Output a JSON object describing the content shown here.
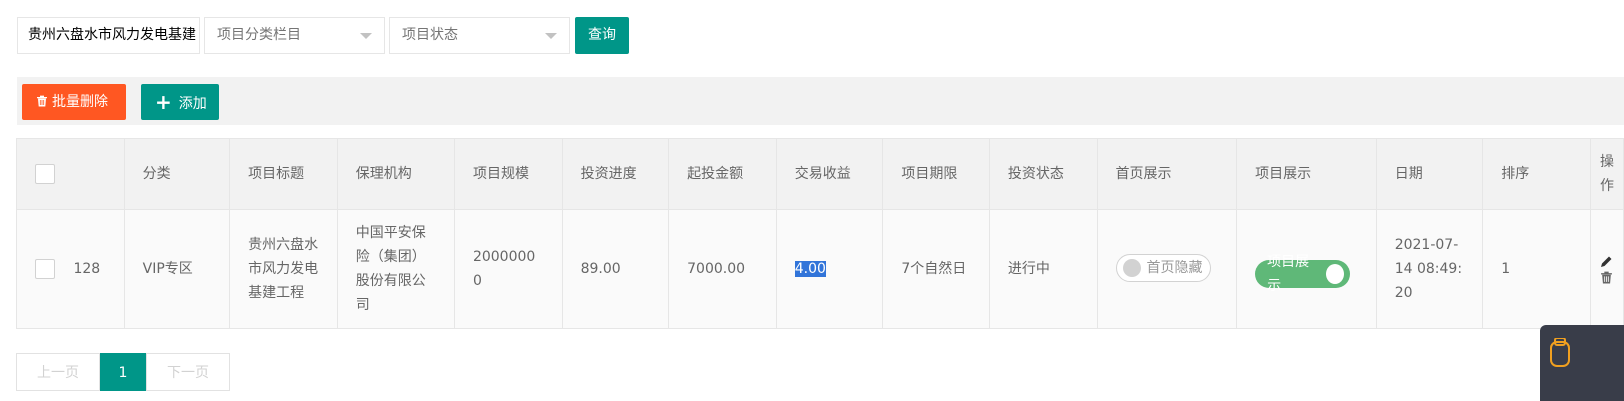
{
  "filters": {
    "project_name_value": "贵州六盘水市风力发电基建",
    "category_select": "项目分类栏目",
    "status_select": "项目状态",
    "query_label": "查询"
  },
  "toolbar": {
    "batch_delete_label": "批量删除",
    "add_label": "添加"
  },
  "table": {
    "headers": [
      "分类",
      "项目标题",
      "保理机构",
      "项目规模",
      "投资进度",
      "起投金额",
      "交易收益",
      "项目期限",
      "投资状态",
      "首页展示",
      "项目展示",
      "日期",
      "排序",
      "操作"
    ],
    "rows": [
      {
        "id": "128",
        "category": "VIP专区",
        "title": "贵州六盘水市风力发电基建工程",
        "factoring_org": "中国平安保险（集团）股份有限公司",
        "scale": "20000000",
        "progress": "89.00",
        "min_invest": "7000.00",
        "yield": "4.00",
        "term": "7个自然日",
        "invest_status": "进行中",
        "home_display": "首页隐藏",
        "home_display_on": false,
        "project_display": "项目展示",
        "project_display_on": true,
        "date": "2021-07-14 08:49:20",
        "sort": "1"
      }
    ]
  },
  "pager": {
    "prev": "上一页",
    "current": "1",
    "next": "下一页"
  },
  "colors": {
    "primary": "#009688",
    "danger": "#ff5722",
    "switch_on": "#5fb878"
  }
}
